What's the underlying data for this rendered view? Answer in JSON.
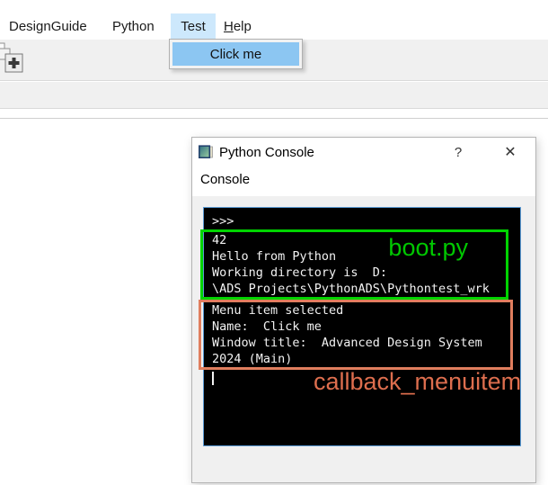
{
  "menubar": {
    "items": [
      {
        "label": "DesignGuide"
      },
      {
        "label": "Python"
      },
      {
        "label": "Test"
      },
      {
        "label_accel": "H",
        "label_rest": "elp"
      }
    ]
  },
  "dropdown": {
    "items": [
      {
        "label": "Click me"
      }
    ]
  },
  "window": {
    "title": "Python Console",
    "help_button": "?",
    "close_button": "✕",
    "dock_title": "Console"
  },
  "console": {
    "prompt": ">>>",
    "lines_boot": [
      "42",
      "Hello from Python",
      "Working directory is  D:",
      "\\ADS Projects\\PythonADS\\Pythontest_wrk"
    ],
    "lines_callback": [
      "Menu item selected",
      "Name:  Click me",
      "Window title:  Advanced Design System",
      "2024 (Main)"
    ]
  },
  "annotations": {
    "boot": {
      "label": "boot.py",
      "color": "#00c800"
    },
    "callback": {
      "label": "callback_menuitem",
      "color": "#dd6e4e"
    }
  },
  "colors": {
    "menu_header_highlight": "#cde8fc",
    "menu_item_highlight": "#8cc6f2",
    "toolbar_bg": "#f0f0f0",
    "console_bg": "#000000",
    "console_text": "#f2f2f2",
    "console_border": "#5b9bd5",
    "boot_box_border": "#00d400",
    "callback_box_border": "#e07e5e"
  }
}
